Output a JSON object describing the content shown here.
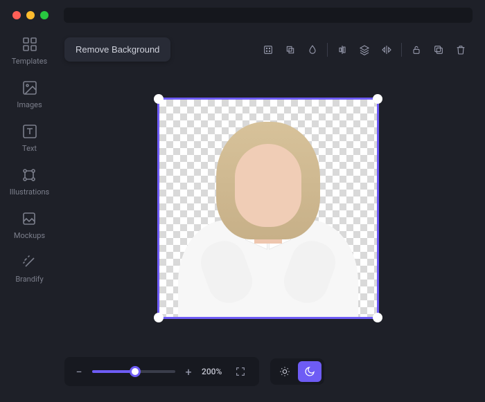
{
  "sidebar": {
    "items": [
      {
        "label": "Templates"
      },
      {
        "label": "Images"
      },
      {
        "label": "Text"
      },
      {
        "label": "Illustrations"
      },
      {
        "label": "Mockups"
      },
      {
        "label": "Brandify"
      }
    ]
  },
  "toolbar": {
    "remove_bg_label": "Remove Background"
  },
  "zoom": {
    "value_label": "200%",
    "percent": 52
  },
  "theme": {
    "mode": "dark"
  },
  "colors": {
    "accent": "#6e5cf5"
  }
}
